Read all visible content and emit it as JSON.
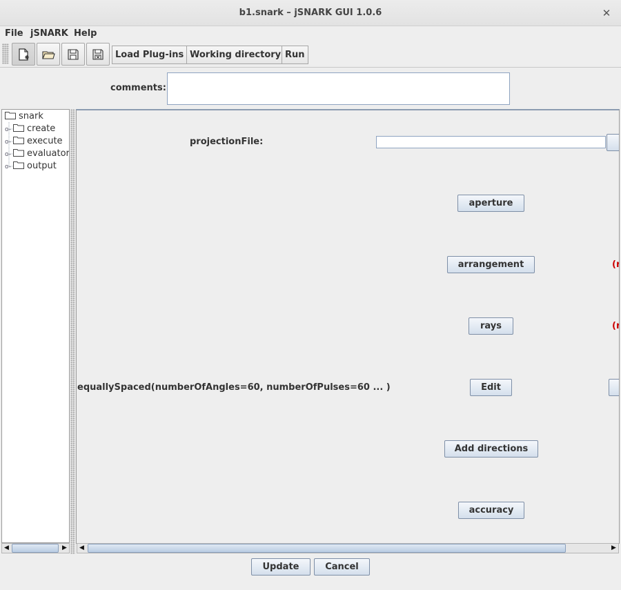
{
  "window": {
    "title": "b1.snark – jSNARK GUI 1.0.6",
    "close_glyph": "✕"
  },
  "menu": {
    "file": "File",
    "jsnark": "jSNARK",
    "help": "Help"
  },
  "toolbar": {
    "icons": [
      "new-file-icon",
      "open-folder-icon",
      "save-icon",
      "save-as-icon"
    ],
    "load_plugins": "Load Plug-ins",
    "working_directory": "Working directory",
    "run": "Run"
  },
  "comments": {
    "label": "comments:",
    "value": ""
  },
  "tree": {
    "root": "snark",
    "children": [
      "create",
      "execute",
      "evaluator",
      "output"
    ]
  },
  "form": {
    "projection_file_label": "projectionFile:",
    "projection_file_value": "",
    "aperture_button": "aperture",
    "arrangement_button": "arrangement",
    "rays_button": "rays",
    "arrangement_marker": "(r",
    "rays_marker": "(r",
    "directions_summary": "equallySpaced(numberOfAngles=60, numberOfPulses=60 ... )",
    "edit_button": "Edit",
    "add_directions_button": "Add directions",
    "accuracy_button": "accuracy"
  },
  "footer": {
    "update": "Update",
    "cancel": "Cancel"
  },
  "colors": {
    "required_marker": "#cc0000",
    "button_border": "#7d8ea6"
  }
}
